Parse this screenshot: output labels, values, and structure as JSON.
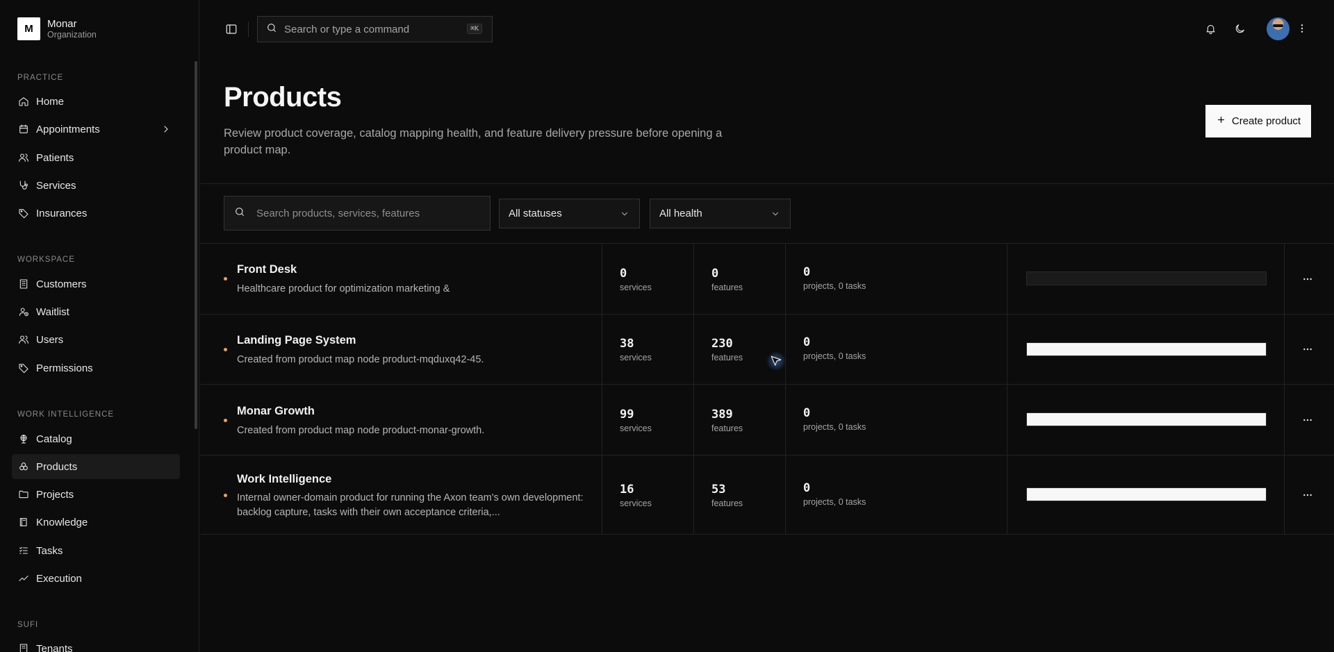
{
  "org": {
    "logo_letter": "M",
    "name": "Monar",
    "subtitle": "Organization"
  },
  "sidebar": {
    "sections": [
      {
        "label": "PRACTICE",
        "items": [
          {
            "label": "Home",
            "icon": "home-icon"
          },
          {
            "label": "Appointments",
            "icon": "calendar-icon",
            "has_chevron": true
          },
          {
            "label": "Patients",
            "icon": "users-icon"
          },
          {
            "label": "Services",
            "icon": "stethoscope-icon"
          },
          {
            "label": "Insurances",
            "icon": "tag-icon"
          }
        ]
      },
      {
        "label": "WORKSPACE",
        "items": [
          {
            "label": "Customers",
            "icon": "building-icon"
          },
          {
            "label": "Waitlist",
            "icon": "user-clock-icon"
          },
          {
            "label": "Users",
            "icon": "users-icon"
          },
          {
            "label": "Permissions",
            "icon": "tag-icon"
          }
        ]
      },
      {
        "label": "WORK INTELLIGENCE",
        "items": [
          {
            "label": "Catalog",
            "icon": "globe-icon"
          },
          {
            "label": "Products",
            "icon": "boxes-icon",
            "active": true
          },
          {
            "label": "Projects",
            "icon": "folder-icon"
          },
          {
            "label": "Knowledge",
            "icon": "book-icon"
          },
          {
            "label": "Tasks",
            "icon": "list-icon"
          },
          {
            "label": "Execution",
            "icon": "activity-icon"
          }
        ]
      },
      {
        "label": "SUFI",
        "items": [
          {
            "label": "Tenants",
            "icon": "building-icon"
          }
        ]
      }
    ]
  },
  "topbar": {
    "search_placeholder": "Search or type a command",
    "shortcut": "⌘K"
  },
  "header": {
    "title": "Products",
    "description": "Review product coverage, catalog mapping health, and feature delivery pressure before opening a product map.",
    "create_label": "Create product"
  },
  "filters": {
    "search_placeholder": "Search products, services, features",
    "status": "All statuses",
    "health": "All health"
  },
  "products": [
    {
      "name": "Front Desk",
      "description": "Healthcare product for optimization marketing &",
      "services": "0",
      "services_label": "services",
      "features": "0",
      "features_label": "features",
      "projects": "0",
      "projects_label": "projects, 0 tasks",
      "coverage": 0
    },
    {
      "name": "Landing Page System",
      "description": "Created from product map node product-mqduxq42-45.",
      "services": "38",
      "services_label": "services",
      "features": "230",
      "features_label": "features",
      "projects": "0",
      "projects_label": "projects, 0 tasks",
      "coverage": 1
    },
    {
      "name": "Monar Growth",
      "description": "Created from product map node product-monar-growth.",
      "services": "99",
      "services_label": "services",
      "features": "389",
      "features_label": "features",
      "projects": "0",
      "projects_label": "projects, 0 tasks",
      "coverage": 1
    },
    {
      "name": "Work Intelligence",
      "description": "Internal owner-domain product for running the Axon team's own development: backlog capture, tasks with their own acceptance criteria,...",
      "services": "16",
      "services_label": "services",
      "features": "53",
      "features_label": "features",
      "projects": "0",
      "projects_label": "projects, 0 tasks",
      "coverage": 1
    }
  ]
}
